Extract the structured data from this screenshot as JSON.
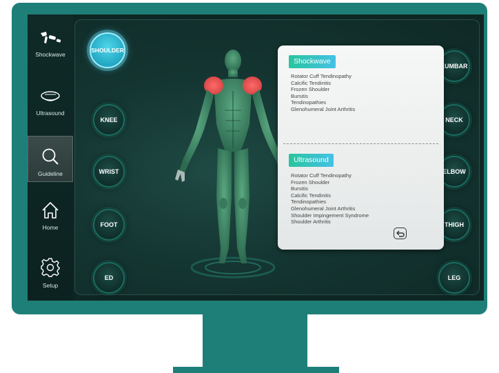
{
  "sidebar": {
    "items": [
      {
        "label": "Shockwave",
        "icon": "shockwave-gun-icon"
      },
      {
        "label": "Ultrasound",
        "icon": "ultrasound-probe-icon"
      },
      {
        "label": "Guideline",
        "icon": "magnifier-icon",
        "active": true
      },
      {
        "label": "Home",
        "icon": "home-icon"
      },
      {
        "label": "Setup",
        "icon": "gear-icon"
      }
    ]
  },
  "body_parts": {
    "left": [
      "SHOULDER",
      "KNEE",
      "WRIST",
      "FOOT",
      "ED"
    ],
    "right": [
      "LUMBAR",
      "NECK",
      "ELBOW",
      "THIGH",
      "LEG"
    ],
    "selected": "SHOULDER"
  },
  "popup": {
    "shockwave_title": "Shockwave",
    "shockwave_items": [
      "Rotator Cuff Tendinopathy",
      "Calcific Tendinitis",
      "Frozen Shoulder",
      "Bursitis",
      "Tendinopathies",
      "Glenohumeral Joint Arthritis"
    ],
    "ultrasound_title": "Ultrasound",
    "ultrasound_items": [
      "Rotator Cuff Tendinopathy",
      "Frozen Shoulder",
      "Bursitis",
      "Calcific Tendinitis",
      "Tendinopathies",
      "Glenohumeral Joint Arthritis",
      "Shoulder Impingement Syndrome",
      "Shoulder Arthritis"
    ],
    "back_icon": "return-arrow-icon"
  },
  "colors": {
    "monitor": "#1e7f78",
    "accent_active": "#36c0dd",
    "highlight": "#e85a5a",
    "muscle": "#3f8a68"
  }
}
